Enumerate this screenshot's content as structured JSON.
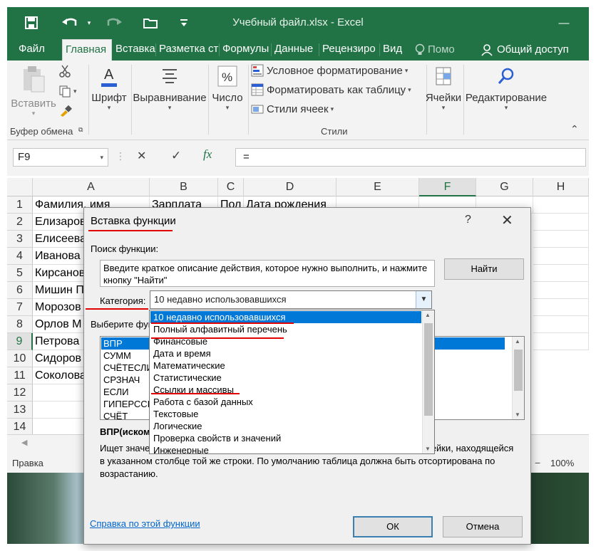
{
  "window": {
    "title": "Учебный файл.xlsx - Excel",
    "controls": {
      "minimize": "—",
      "close": "✕"
    }
  },
  "ribbon_tabs": [
    "Файл",
    "Главная",
    "Вставка",
    "Разметка ст",
    "Формулы",
    "Данные",
    "Рецензиро",
    "Вид"
  ],
  "tell_me": "Помо",
  "share": "Общий доступ",
  "ribbon": {
    "paste": "Вставить",
    "font": "Шрифт",
    "alignment": "Выравнивание",
    "number": "Число",
    "cond_format": "Условное форматирование",
    "format_table": "Форматировать как таблицу",
    "cell_styles": "Стили ячеек",
    "cells": "Ячейки",
    "editing": "Редактирование",
    "group_clipboard": "Буфер обмена",
    "group_styles": "Стили"
  },
  "formula_bar": {
    "name_box": "F9",
    "cancel": "✕",
    "enter": "✓",
    "fx": "fx",
    "value": "="
  },
  "sheet": {
    "columns": [
      "A",
      "B",
      "C",
      "D",
      "E",
      "F",
      "G",
      "H"
    ],
    "selected_column": "F",
    "selected_row": "9",
    "row_numbers": [
      "1",
      "2",
      "3",
      "4",
      "5",
      "6",
      "7",
      "8",
      "9",
      "10",
      "11",
      "12",
      "13",
      "14"
    ],
    "rows": [
      [
        "Фамилия, имя",
        "Зарплата",
        "Пол",
        "Дата рождения"
      ],
      [
        "Елизаров"
      ],
      [
        "Елисеева"
      ],
      [
        "Иванова"
      ],
      [
        "Кирсанов"
      ],
      [
        "Мишин П"
      ],
      [
        "Морозов"
      ],
      [
        "Орлов М"
      ],
      [
        "Петрова"
      ],
      [
        "Сидоров"
      ],
      [
        "Соколова"
      ]
    ]
  },
  "status": {
    "mode": "Правка",
    "zoom": "100%"
  },
  "dialog": {
    "title": "Вставка функции",
    "help": "?",
    "close": "✕",
    "search_label": "Поиск функции:",
    "search_text": "Введите краткое описание действия, которое нужно выполнить, и нажмите кнопку \"Найти\"",
    "find_button": "Найти",
    "category_label": "Категория:",
    "category_value": "10 недавно использовавшихся",
    "select_label": "Выберите фун",
    "functions": [
      "ВПР",
      "СУММ",
      "СЧЁТЕСЛИ",
      "СРЗНАЧ",
      "ЕСЛИ",
      "ГИПЕРССЫ",
      "СЧЁТ"
    ],
    "selected_function": "ВПР",
    "signature_start": "ВПР(иском",
    "signature_end": ")",
    "description_line1_start": "Ищет значе",
    "description_line1_end": "чейки, находящейся",
    "description_line2": "в указанном столбце той же строки. По умолчанию таблица должна быть отсортирована по",
    "description_line3": "возрастанию.",
    "help_link": "Справка по этой функции",
    "ok": "ОК",
    "cancel": "Отмена"
  },
  "category_dropdown": {
    "options": [
      "10 недавно использовавшихся",
      "Полный алфавитный перечень",
      "Финансовые",
      "Дата и время",
      "Математические",
      "Статистические",
      "Ссылки и массивы",
      "Работа с базой данных",
      "Текстовые",
      "Логические",
      "Проверка свойств и значений",
      "Инженерные"
    ],
    "selected": "10 недавно использовавшихся"
  },
  "colors": {
    "excel_green": "#217346",
    "selection_blue": "#0078d7",
    "annotation_red": "#e00000"
  }
}
